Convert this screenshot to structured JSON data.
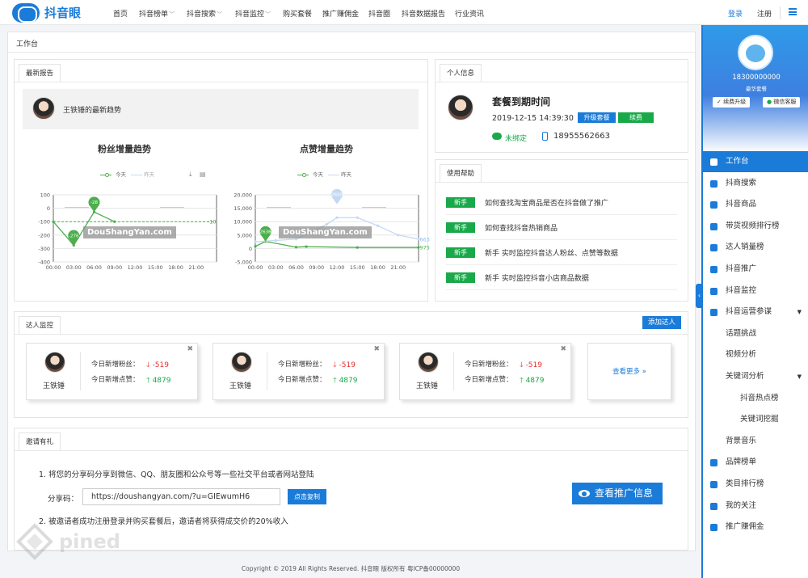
{
  "brand": {
    "name": "抖音眼"
  },
  "nav": {
    "items": [
      {
        "label": "首页",
        "dropdown": false
      },
      {
        "label": "抖音榜单",
        "dropdown": true
      },
      {
        "label": "抖音搜索",
        "dropdown": true
      },
      {
        "label": "抖音监控",
        "dropdown": true
      },
      {
        "label": "购买套餐",
        "dropdown": false
      },
      {
        "label": "推广赚佣金",
        "dropdown": false
      },
      {
        "label": "抖音圈",
        "dropdown": false
      },
      {
        "label": "抖音数据报告",
        "dropdown": false
      },
      {
        "label": "行业资讯",
        "dropdown": false
      }
    ],
    "login": "登录",
    "register": "注册"
  },
  "workspace": {
    "title": "工作台"
  },
  "report": {
    "tab": "最新报告",
    "header": "王铁锤的最新趋势",
    "watermark": "DouShangYan.com",
    "legend_today": "今天",
    "legend_yesterday": "昨天",
    "fans_chart_title": "粉丝增量趋势",
    "likes_chart_title": "点赞增量趋势"
  },
  "chart_data": [
    {
      "type": "line",
      "title": "粉丝增量趋势",
      "categories": [
        "00:00",
        "03:00",
        "06:00",
        "09:00",
        "12:00",
        "15:00",
        "18:00",
        "21:00"
      ],
      "ylim": [
        -400,
        100
      ],
      "yticks": [
        "100",
        "0",
        "-100",
        "-200",
        "-300",
        "-400"
      ],
      "series": [
        {
          "name": "今天",
          "color": "#4cae4c",
          "x": [
            0,
            1,
            2,
            3
          ],
          "values": [
            -100,
            -276,
            -28,
            -100
          ]
        },
        {
          "name": "昨天",
          "color": "#c3d9f3",
          "x": [],
          "values": []
        }
      ],
      "annotations": [
        {
          "label": "-276",
          "x": 1,
          "y": -276
        },
        {
          "label": "-28",
          "x": 2,
          "y": -28
        },
        {
          "label": "-10",
          "x": 7.4,
          "y": -100
        }
      ],
      "reference_line": -100
    },
    {
      "type": "line",
      "title": "点赞增量趋势",
      "categories": [
        "00:00",
        "03:00",
        "06:00",
        "09:00",
        "12:00",
        "15:00",
        "18:00",
        "21:00"
      ],
      "ylim": [
        -5000,
        20000
      ],
      "yticks": [
        "20,000",
        "15,000",
        "10,000",
        "5,000",
        "0",
        "-5,000"
      ],
      "series": [
        {
          "name": "今天",
          "color": "#4cae4c",
          "x": [
            0,
            0.5,
            2,
            2.5,
            5,
            8
          ],
          "values": [
            800,
            2636,
            500,
            700,
            400,
            400
          ]
        },
        {
          "name": "昨天",
          "color": "#c3d9f3",
          "x": [
            0,
            1,
            2,
            3.5,
            4,
            5,
            6,
            7,
            8
          ],
          "values": [
            2500,
            3000,
            3500,
            9000,
            11500,
            11500,
            8500,
            5000,
            3500
          ]
        }
      ],
      "annotations": [
        {
          "label": "2636",
          "x": 0.5,
          "y": 2636
        },
        {
          "label": "2600",
          "x": 4,
          "y": 16500
        },
        {
          "label": "975",
          "x": 7.9,
          "y": 400
        },
        {
          "label": "663",
          "x": 7.9,
          "y": 3500
        }
      ]
    }
  ],
  "profile": {
    "tab": "个人信息",
    "plan_title": "套餐到期时间",
    "expiry": "2019-12-15 14:39:30",
    "upgrade": "升级套餐",
    "renew": "续费",
    "wechat_status": "未绑定",
    "phone": "18955562663"
  },
  "help": {
    "tab": "使用帮助",
    "items": [
      {
        "tag": "新手",
        "text": "如何查找淘宝商品是否在抖音做了推广"
      },
      {
        "tag": "新手",
        "text": "如何查找抖音热销商品"
      },
      {
        "tag": "新手",
        "text": "新手 实时监控抖音达人粉丝、点赞等数据"
      },
      {
        "tag": "新手",
        "text": "新手 实时监控抖音小店商品数据"
      }
    ]
  },
  "monitor": {
    "tab": "达人监控",
    "add": "添加达人",
    "see_more": "查看更多 »",
    "cards": [
      {
        "name": "王铁锤",
        "fans_label": "今日新增粉丝：",
        "fans": "-519",
        "likes_label": "今日新增点赞：",
        "likes": "4879"
      },
      {
        "name": "王铁锤",
        "fans_label": "今日新增粉丝：",
        "fans": "-519",
        "likes_label": "今日新增点赞：",
        "likes": "4879"
      },
      {
        "name": "王铁锤",
        "fans_label": "今日新增粉丝：",
        "fans": "-519",
        "likes_label": "今日新增点赞：",
        "likes": "4879"
      }
    ]
  },
  "invite": {
    "tab": "邀请有礼",
    "line1": "1. 将您的分享码分享到微信、QQ、朋友圈和公众号等一些社交平台或者网站登陆",
    "code_label": "分享码：",
    "code": "https://doushangyan.com/?u=GIEwumH6",
    "copy": "点击复制",
    "line2": "2. 被邀请者成功注册登录并购买套餐后，邀请者将获得成交价的20%收入",
    "promo": "查看推广信息"
  },
  "footer": "Copyright © 2019  All Rights Reserved. 抖音眼 版权所有 粤ICP备00000000",
  "sidebar": {
    "user": "18300000000",
    "plan": "豪华套餐",
    "renew_upgrade": "续费升级",
    "wechat_service": "微信客服",
    "menu": [
      {
        "label": "工作台",
        "active": true,
        "level": 0,
        "icon": "bar-chart-icon"
      },
      {
        "label": "抖商搜索",
        "level": 0,
        "icon": "search-icon"
      },
      {
        "label": "抖音商品",
        "level": 0,
        "icon": "product-icon"
      },
      {
        "label": "带货视频排行榜",
        "level": 0,
        "icon": "video-icon"
      },
      {
        "label": "达人销量榜",
        "level": 0,
        "icon": "list-icon"
      },
      {
        "label": "抖音推广",
        "level": 0,
        "icon": "promo-icon"
      },
      {
        "label": "抖音监控",
        "level": 0,
        "icon": "camera-icon"
      },
      {
        "label": "抖音运营参谋",
        "level": 0,
        "icon": "gear-icon",
        "caret": true
      },
      {
        "label": "话题挑战",
        "level": 1
      },
      {
        "label": "视频分析",
        "level": 1
      },
      {
        "label": "关键词分析",
        "level": 1,
        "caret": true
      },
      {
        "label": "抖音热点榜",
        "level": 2
      },
      {
        "label": "关键词挖掘",
        "level": 2
      },
      {
        "label": "背景音乐",
        "level": 1
      },
      {
        "label": "品牌榜单",
        "level": 0,
        "icon": "target-icon"
      },
      {
        "label": "类目排行榜",
        "level": 0,
        "icon": "category-icon"
      },
      {
        "label": "我的关注",
        "level": 0,
        "icon": "eye-icon"
      },
      {
        "label": "推广赚佣金",
        "level": 0,
        "icon": "money-icon"
      }
    ]
  }
}
